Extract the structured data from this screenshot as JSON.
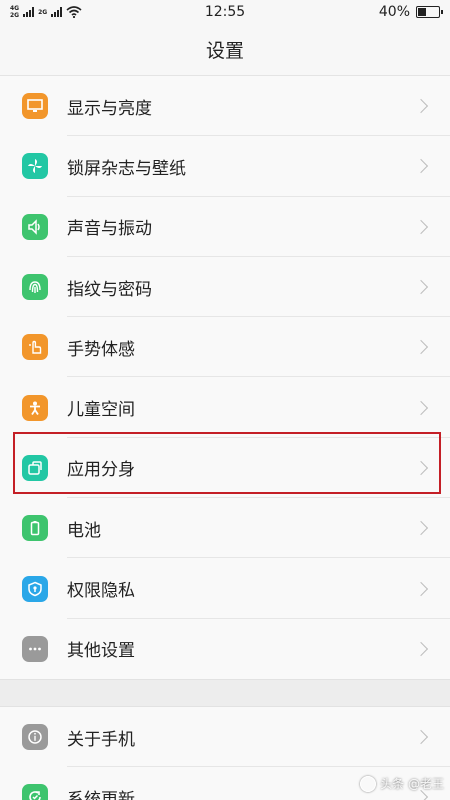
{
  "status_bar": {
    "net_top": "4G",
    "net_bottom": "2G",
    "net_top2": "2G",
    "time": "12:55",
    "battery_text": "40%",
    "battery_level": 0.4
  },
  "header": {
    "title": "设置"
  },
  "items": [
    {
      "label": "显示与亮度",
      "icon": "display-icon",
      "color": "#f2962b"
    },
    {
      "label": "锁屏杂志与壁纸",
      "icon": "pinwheel-icon",
      "color": "#22c7a4"
    },
    {
      "label": "声音与振动",
      "icon": "speaker-icon",
      "color": "#3ec46e"
    },
    {
      "label": "指纹与密码",
      "icon": "fingerprint-icon",
      "color": "#3ec46e"
    },
    {
      "label": "手势体感",
      "icon": "hand-gesture-icon",
      "color": "#f2962b"
    },
    {
      "label": "儿童空间",
      "icon": "child-icon",
      "color": "#f2962b"
    },
    {
      "label": "应用分身",
      "icon": "app-clone-icon",
      "color": "#22c7a4"
    },
    {
      "label": "电池",
      "icon": "battery-icon",
      "color": "#3ec46e"
    },
    {
      "label": "权限隐私",
      "icon": "shield-icon",
      "color": "#2aa7e8"
    },
    {
      "label": "其他设置",
      "icon": "more-icon",
      "color": "#9a9a9a"
    }
  ],
  "items2": [
    {
      "label": "关于手机",
      "icon": "info-icon",
      "color": "#9a9a9a"
    },
    {
      "label": "系统更新",
      "icon": "update-icon",
      "color": "#3ec46e"
    }
  ],
  "watermark": {
    "text": "头条 @老王"
  },
  "highlight_color": "#c41f26"
}
